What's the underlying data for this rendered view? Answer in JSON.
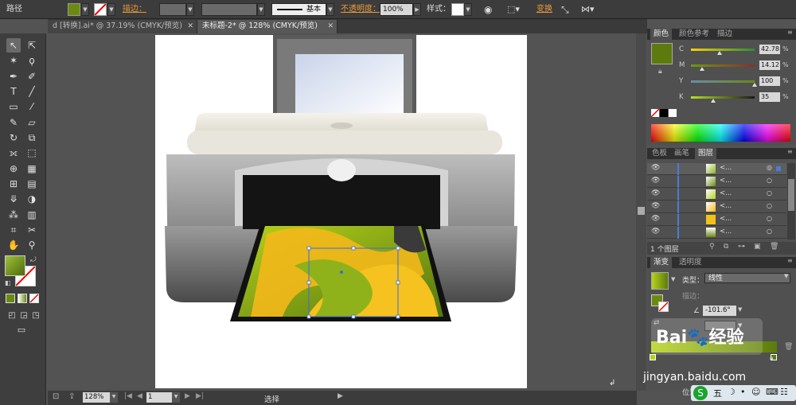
{
  "control_bar": {
    "object_type": "路径",
    "stroke_label": "描边：",
    "stroke_profile": "基本",
    "opacity_label": "不透明度：",
    "opacity_value": "100%",
    "style_label": "样式：",
    "transform_label": "变换"
  },
  "tabs": [
    {
      "label": "d [转换].ai* @ 37.19% (CMYK/预览)",
      "active": false
    },
    {
      "label": "未标题-2* @ 128% (CMYK/预览)",
      "active": true
    }
  ],
  "color_panel": {
    "tabs": [
      "颜色",
      "颜色参考",
      "描边"
    ],
    "active_tab": "颜色",
    "channels": [
      {
        "name": "C",
        "value": "42.78"
      },
      {
        "name": "M",
        "value": "14.12"
      },
      {
        "name": "Y",
        "value": "100"
      },
      {
        "name": "K",
        "value": "35"
      }
    ],
    "unit": "%",
    "fill_color": "#5d7a0e"
  },
  "layers_panel": {
    "tabs": [
      "色板",
      "画笔",
      "图层"
    ],
    "active_tab": "图层",
    "rows": [
      {
        "name": "<..."
      },
      {
        "name": "<..."
      },
      {
        "name": "<..."
      },
      {
        "name": "<..."
      },
      {
        "name": "<..."
      },
      {
        "name": "<..."
      }
    ],
    "footer_label": "1 个图层"
  },
  "gradient_panel": {
    "tabs": [
      "渐变",
      "透明度"
    ],
    "active_tab": "渐变",
    "type_label": "类型：",
    "type_value": "线性",
    "stroke_label": "描边：",
    "angle_value": "-101.6°",
    "location_label": "位置"
  },
  "status_bar": {
    "zoom": "128%",
    "page": "1",
    "tool": "选择"
  },
  "watermark": {
    "text": "Bai🐾经验",
    "url": "jingyan.baidu.com"
  },
  "taskbar": {
    "ime_label": "五"
  }
}
